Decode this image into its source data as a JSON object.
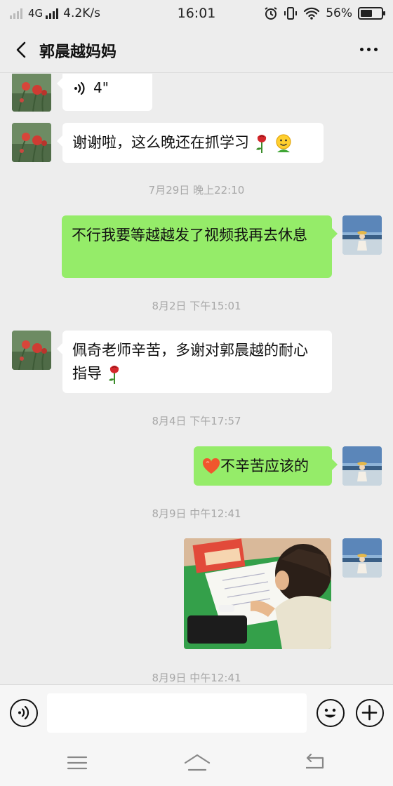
{
  "status_bar": {
    "network": "4G",
    "speed": "4.2K/s",
    "time": "16:01",
    "battery_percent": "56%",
    "battery_level": 0.56
  },
  "header": {
    "title": "郭晨越妈妈",
    "back_icon": "chevron-left-icon",
    "more_icon": "more-horizontal-icon"
  },
  "chat": {
    "voice_message": {
      "duration": "4\""
    },
    "msg_thanks": {
      "text": "谢谢啦，这么晚还在抓学习",
      "emojis": [
        "rose",
        "smile-face"
      ]
    },
    "ts1": "7月29日 晚上22:10",
    "msg_waiting": {
      "text": "不行我要等越越发了视频我再去休息"
    },
    "ts2": "8月2日 下午15:01",
    "msg_gratitude": {
      "text": "佩奇老师辛苦，多谢对郭晨越的耐心指导",
      "emojis": [
        "rose"
      ]
    },
    "ts3": "8月4日 下午17:57",
    "msg_reply": {
      "text": "不辛苦应该的",
      "emojis": [
        "heart"
      ]
    },
    "ts4": "8月9日 中午12:41",
    "ts5": "8月9日 中午12:41"
  },
  "input_bar": {
    "voice_icon": "voice-toggle-icon",
    "emoji_icon": "emoji-icon",
    "plus_icon": "plus-icon",
    "input_value": ""
  },
  "nav_bar": {
    "icons": [
      "menu-icon",
      "home-icon",
      "back-icon"
    ]
  },
  "colors": {
    "background": "#ededed",
    "incoming_bubble": "#ffffff",
    "outgoing_bubble": "#95ec69",
    "timestamp": "#a8a8a8"
  }
}
